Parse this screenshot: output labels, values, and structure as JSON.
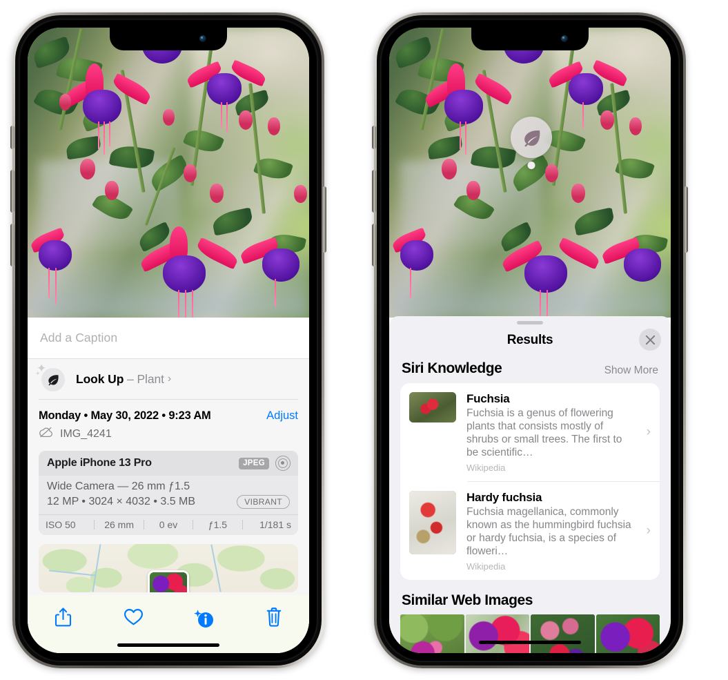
{
  "left_phone": {
    "photo_alt": "Fuchsia flowers hanging plant on a porch",
    "caption": {
      "placeholder": "Add a Caption",
      "value": ""
    },
    "lookup": {
      "icon": "leaf-icon",
      "sparkle_icon": "sparkle-icon",
      "label": "Look Up",
      "dash": "–",
      "subject": "Plant",
      "chevron": "›"
    },
    "meta": {
      "date": "Monday • May 30, 2022 • 9:23 AM",
      "adjust_label": "Adjust",
      "cloud_icon": "cloud-slash-icon",
      "filename": "IMG_4241"
    },
    "exif": {
      "device": "Apple iPhone 13 Pro",
      "format_badge": "JPEG",
      "raw_icon": "raw-circle-icon",
      "lens_line": "Wide Camera — 26 mm ƒ1.5",
      "size_line": "12 MP • 3024 × 4032 • 3.5 MB",
      "style_badge": "VIBRANT",
      "stats": [
        "ISO 50",
        "26 mm",
        "0 ev",
        "ƒ1.5",
        "1/181 s"
      ]
    },
    "map": {
      "pin_icon": "photo-pin"
    },
    "toolbar": [
      {
        "name": "share-button",
        "icon": "share-icon"
      },
      {
        "name": "favorite-button",
        "icon": "heart-icon"
      },
      {
        "name": "info-button",
        "icon": "info-sparkle-icon"
      },
      {
        "name": "delete-button",
        "icon": "trash-icon"
      }
    ],
    "accent_color": "#007AFF"
  },
  "right_phone": {
    "lookup_bubble": {
      "icon": "leaf-icon"
    },
    "sheet": {
      "title": "Results",
      "close_icon": "close-icon",
      "sections": [
        {
          "title": "Siri Knowledge",
          "action": "Show More",
          "items": [
            {
              "title": "Fuchsia",
              "description": "Fuchsia is a genus of flowering plants that consists mostly of shrubs or small trees. The first to be scientific…",
              "source": "Wikipedia",
              "chevron": "›",
              "thumb": "fuchsia-red-flowers"
            },
            {
              "title": "Hardy fuchsia",
              "description": "Fuchsia magellanica, commonly known as the hummingbird fuchsia or hardy fuchsia, is a species of floweri…",
              "source": "Wikipedia",
              "chevron": "›",
              "thumb": "hardy-fuchsia-specimen"
            }
          ]
        },
        {
          "title": "Similar Web Images",
          "action": "",
          "thumbnails": [
            "fuchsia-pink-white",
            "fuchsia-red-closeup",
            "fuchsia-bush",
            "fuchsia-purple-red"
          ]
        }
      ]
    }
  }
}
